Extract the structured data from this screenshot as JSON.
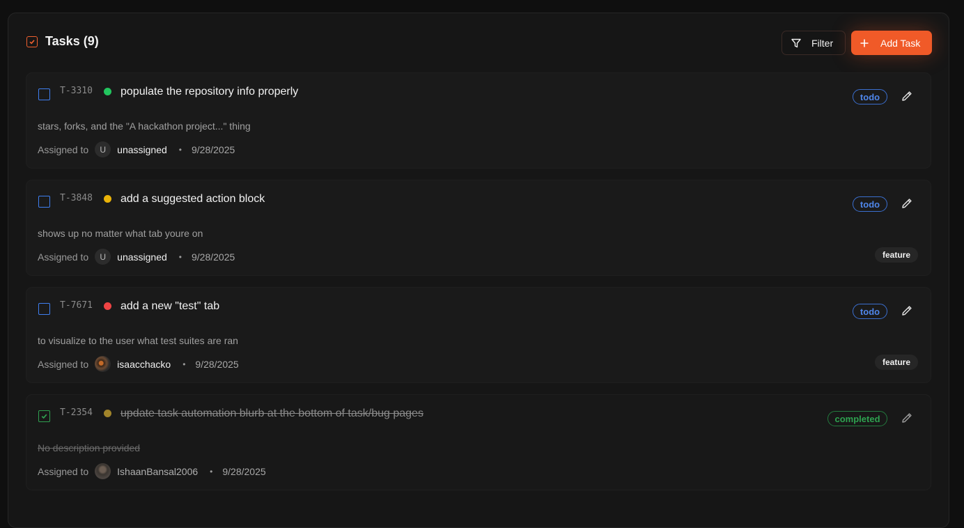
{
  "header": {
    "title": "Tasks (9)",
    "filter_label": "Filter",
    "add_label": "Add Task"
  },
  "colors": {
    "accent": "#f05a28",
    "todo": "#4f86ea",
    "completed": "#2ea350",
    "priority_low": "#22c55e",
    "priority_medium": "#eab308",
    "priority_high": "#ef4444",
    "priority_done": "#a1842a"
  },
  "assigned_label": "Assigned to",
  "tasks": [
    {
      "id": "T-3310",
      "priority": "low",
      "title": "populate the repository info properly",
      "description": "stars, forks, and the \"A hackathon project...\" thing",
      "avatar_initial": "U",
      "assignee": "unassigned",
      "date": "9/28/2025",
      "status": "todo",
      "tag": ""
    },
    {
      "id": "T-3848",
      "priority": "medium",
      "title": "add a suggested action block",
      "description": "shows up no matter what tab youre on",
      "avatar_initial": "U",
      "assignee": "unassigned",
      "date": "9/28/2025",
      "status": "todo",
      "tag": "feature"
    },
    {
      "id": "T-7671",
      "priority": "high",
      "title": "add a new \"test\" tab",
      "description": "to visualize to the user what test suites are ran",
      "avatar_initial": "",
      "assignee": "isaacchacko",
      "date": "9/28/2025",
      "status": "todo",
      "tag": "feature"
    },
    {
      "id": "T-2354",
      "priority": "done",
      "title": "update task automation blurb at the bottom of task/bug pages",
      "description": "No description provided",
      "avatar_initial": "",
      "assignee": "IshaanBansal2006",
      "date": "9/28/2025",
      "status": "completed",
      "tag": ""
    }
  ]
}
